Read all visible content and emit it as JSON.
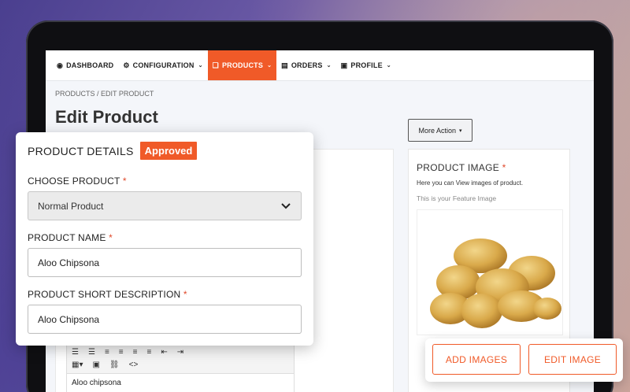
{
  "nav": {
    "items": [
      {
        "label": "DASHBOARD",
        "icon": "dashboard-icon",
        "glyph": "◉",
        "caret": false,
        "active": false
      },
      {
        "label": "CONFIGURATION",
        "icon": "gear-icon",
        "glyph": "⚙",
        "caret": true,
        "active": false
      },
      {
        "label": "PRODUCTS",
        "icon": "products-icon",
        "glyph": "❏",
        "caret": true,
        "active": true
      },
      {
        "label": "ORDERS",
        "icon": "orders-icon",
        "glyph": "▤",
        "caret": true,
        "active": false
      },
      {
        "label": "PROFILE",
        "icon": "profile-icon",
        "glyph": "▣",
        "caret": true,
        "active": false
      }
    ],
    "caret_glyph": "⌄"
  },
  "breadcrumb": "PRODUCTS / EDIT PRODUCT",
  "page_title": "Edit Product",
  "more_action": {
    "label": "More Action",
    "caret": "▾"
  },
  "details": {
    "title": "PRODUCT DETAILS",
    "status": "Approved",
    "choose_product_label": "CHOOSE PRODUCT",
    "choose_product_value": "Normal Product",
    "product_name_label": "PRODUCT NAME",
    "product_name_value": "Aloo Chipsona",
    "short_desc_label": "PRODUCT SHORT DESCRIPTION",
    "short_desc_value": "Aloo Chipsona",
    "required_mark": "*"
  },
  "editor": {
    "text": "Aloo chipsona"
  },
  "image_panel": {
    "title": "PRODUCT IMAGE",
    "required_mark": "*",
    "subtitle": "Here you can View images of product.",
    "feature_label": "This is your Feature Image"
  },
  "buttons": {
    "add_images": "ADD IMAGES",
    "edit_image": "EDIT IMAGE"
  },
  "colors": {
    "accent": "#f05a28",
    "required": "#e0492b"
  }
}
